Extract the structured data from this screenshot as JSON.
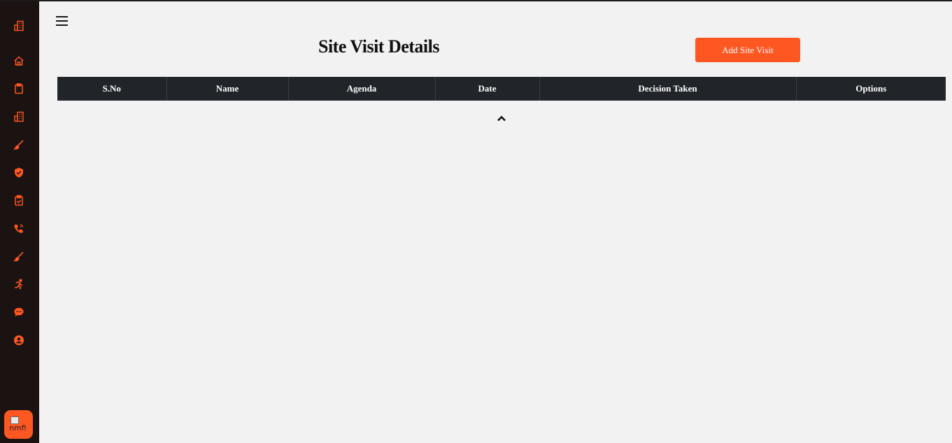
{
  "sidebar": {
    "logo_icon": "building-icon",
    "items": [
      {
        "icon": "home-icon"
      },
      {
        "icon": "clipboard-icon"
      },
      {
        "icon": "building-icon"
      },
      {
        "icon": "brush-icon"
      },
      {
        "icon": "shield-check-icon"
      },
      {
        "icon": "clipboard-check-icon"
      },
      {
        "icon": "phone-icon"
      },
      {
        "icon": "brush-icon"
      },
      {
        "icon": "running-person-icon"
      },
      {
        "icon": "chat-icon"
      },
      {
        "icon": "user-circle-icon"
      }
    ],
    "avatar_alt": "nmfi",
    "accent": "#ff5722",
    "background": "#1b1311"
  },
  "header": {
    "menu_icon": "hamburger-icon",
    "title": "Site Visit Details",
    "add_button_label": "Add Site Visit"
  },
  "table": {
    "columns": [
      "S.No",
      "Name",
      "Agenda",
      "Date",
      "Decision Taken",
      "Options"
    ],
    "rows": [],
    "sort_icon": "chevron-up-icon"
  }
}
